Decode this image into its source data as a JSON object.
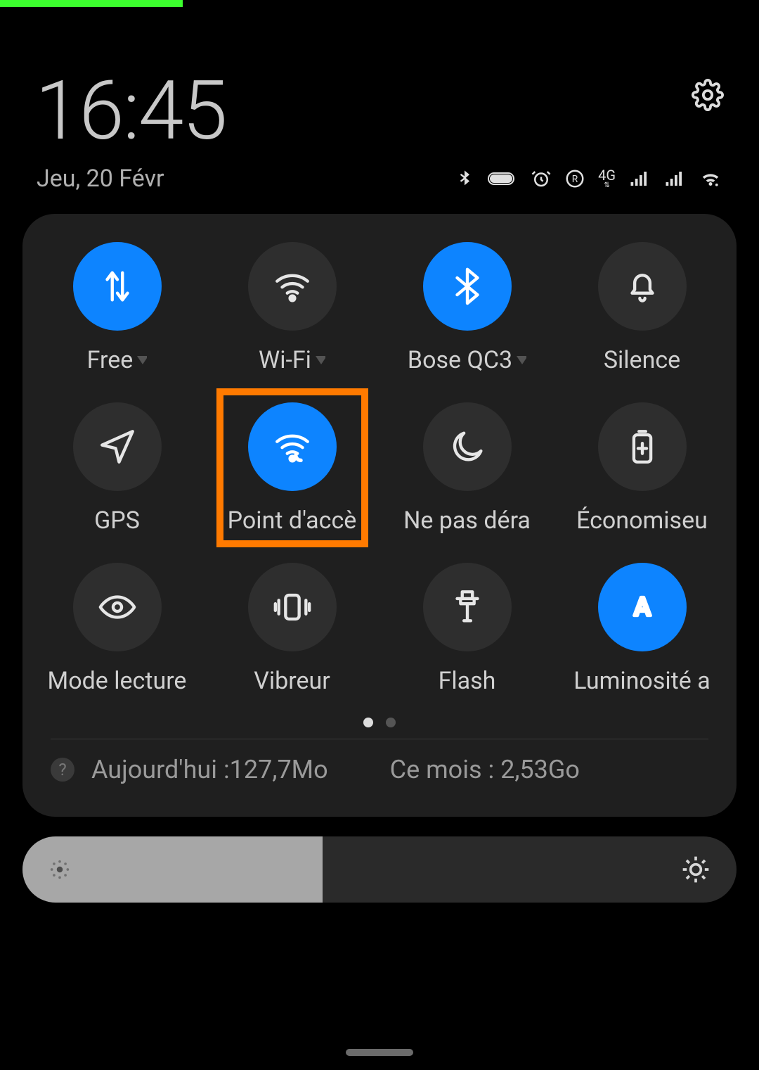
{
  "header": {
    "time": "16:45",
    "date": "Jeu, 20 Févr"
  },
  "tiles": [
    {
      "label": "Free",
      "icon": "mobile-data",
      "active": true,
      "chevron": true,
      "highlight": false
    },
    {
      "label": "Wi-Fi",
      "icon": "wifi",
      "active": false,
      "chevron": true,
      "highlight": false
    },
    {
      "label": "Bose QC3",
      "icon": "bluetooth",
      "active": true,
      "chevron": true,
      "highlight": false
    },
    {
      "label": "Silence",
      "icon": "bell",
      "active": false,
      "chevron": false,
      "highlight": false
    },
    {
      "label": "GPS",
      "icon": "location",
      "active": false,
      "chevron": false,
      "highlight": false
    },
    {
      "label": "Point d'accè",
      "icon": "hotspot",
      "active": true,
      "chevron": false,
      "highlight": true
    },
    {
      "label": "Ne pas déra",
      "icon": "moon",
      "active": false,
      "chevron": false,
      "highlight": false
    },
    {
      "label": "Économiseu",
      "icon": "battery",
      "active": false,
      "chevron": false,
      "highlight": false
    },
    {
      "label": "Mode lecture",
      "icon": "eye",
      "active": false,
      "chevron": false,
      "highlight": false
    },
    {
      "label": "Vibreur",
      "icon": "vibrate",
      "active": false,
      "chevron": false,
      "highlight": false
    },
    {
      "label": "Flash",
      "icon": "flash",
      "active": false,
      "chevron": false,
      "highlight": false
    },
    {
      "label": "Luminosité a",
      "icon": "auto-brightness",
      "active": true,
      "chevron": false,
      "highlight": false
    }
  ],
  "pager": {
    "count": 2,
    "active": 0
  },
  "data_usage": {
    "today_label": "Aujourd'hui :127,7Mo",
    "month_label": "Ce mois : 2,53Go"
  },
  "brightness_percent": 42,
  "status": {
    "network_type": "4G"
  }
}
